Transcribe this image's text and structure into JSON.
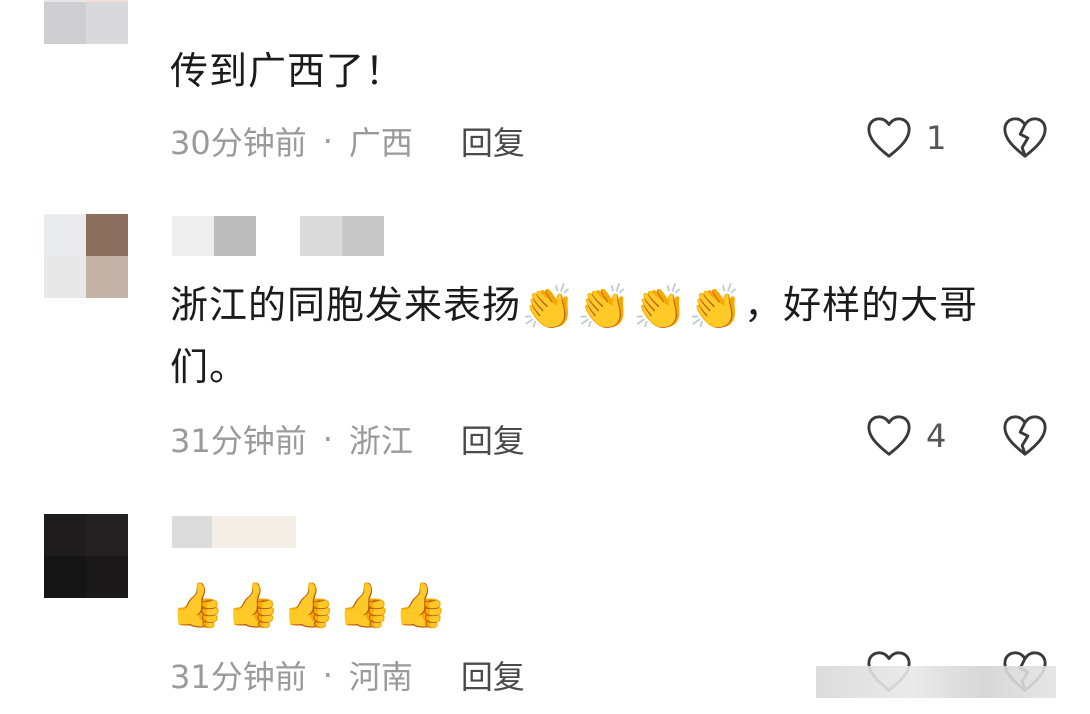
{
  "comments": [
    {
      "text": "传到广西了！",
      "emojis": "",
      "time": "30分钟前",
      "location": "广西",
      "reply_label": "回复",
      "likes": "1"
    },
    {
      "text": "浙江的同胞发来表扬",
      "emojis": "👏👏👏👏",
      "text_after": "，好样的大哥",
      "text_line2": "们。",
      "time": "31分钟前",
      "location": "浙江",
      "reply_label": "回复",
      "likes": "4"
    },
    {
      "text": "",
      "emojis": "👍👍👍👍👍",
      "time": "31分钟前",
      "location": "河南",
      "reply_label": "回复",
      "likes": ""
    }
  ],
  "meta_separator": "·",
  "colors": {
    "text": "#1b1b1b",
    "meta": "#9a9a9a",
    "reply": "#4a4a4a",
    "icon_stroke": "#3a3a3a"
  },
  "icons": {
    "like": "heart-outline-icon",
    "dislike": "broken-heart-icon"
  }
}
